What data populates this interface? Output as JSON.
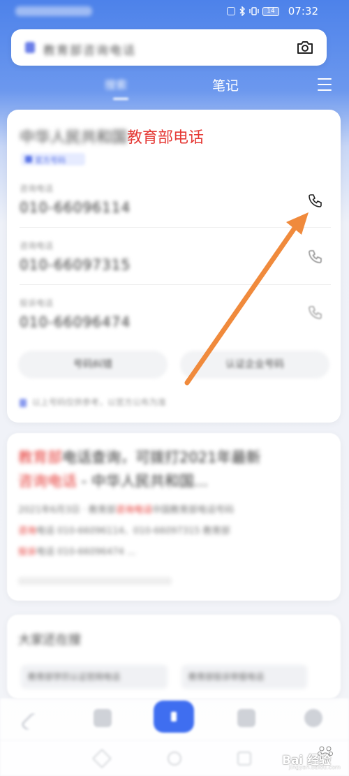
{
  "status_bar": {
    "time": "07:32",
    "battery": "14"
  },
  "search": {
    "query": "教育部咨询电话"
  },
  "tabs": [
    {
      "label": "搜索"
    },
    {
      "label": "笔记"
    }
  ],
  "result_card": {
    "title_blurred": "中华人民共和国",
    "title_highlight": "教育部电话",
    "tag": "官方号码",
    "entries": [
      {
        "label": "咨询电话",
        "number": "010-66096114"
      },
      {
        "label": "咨询电话",
        "number": "010-66097315"
      },
      {
        "label": "投诉电话",
        "number": "010-66096474"
      }
    ],
    "buttons": [
      "号码纠错",
      "认证企业号码"
    ],
    "footnote": "以上号码仅供参考，以官方公布为准"
  },
  "article_card": {
    "title_red": "教育部",
    "title_rest": "电话查询，可拨打2021年最新",
    "title_red2": "咨询电话",
    "title_rest2": " - 中华人民共和国...",
    "body_line1": "2021年6月3日 · 教育部",
    "body_red1": "咨询电话",
    "body_line1b": "中国教育部电话号码",
    "body_red2": "咨询",
    "body_line2": "电话 010-66096114、010-66097315 教育部",
    "body_red3": "投诉",
    "body_line3": "电话 010-66096474 ..."
  },
  "related_card": {
    "title": "大家还在搜",
    "pills": [
      "教育部学历认证官网电话",
      "教育部投诉举报电话"
    ]
  },
  "watermark": {
    "text": "Bai 经验",
    "sub": "jingyan.baidu.com"
  },
  "colors": {
    "accent": "#3f6ef0",
    "highlight": "#e53935",
    "arrow": "#f08a3c"
  }
}
